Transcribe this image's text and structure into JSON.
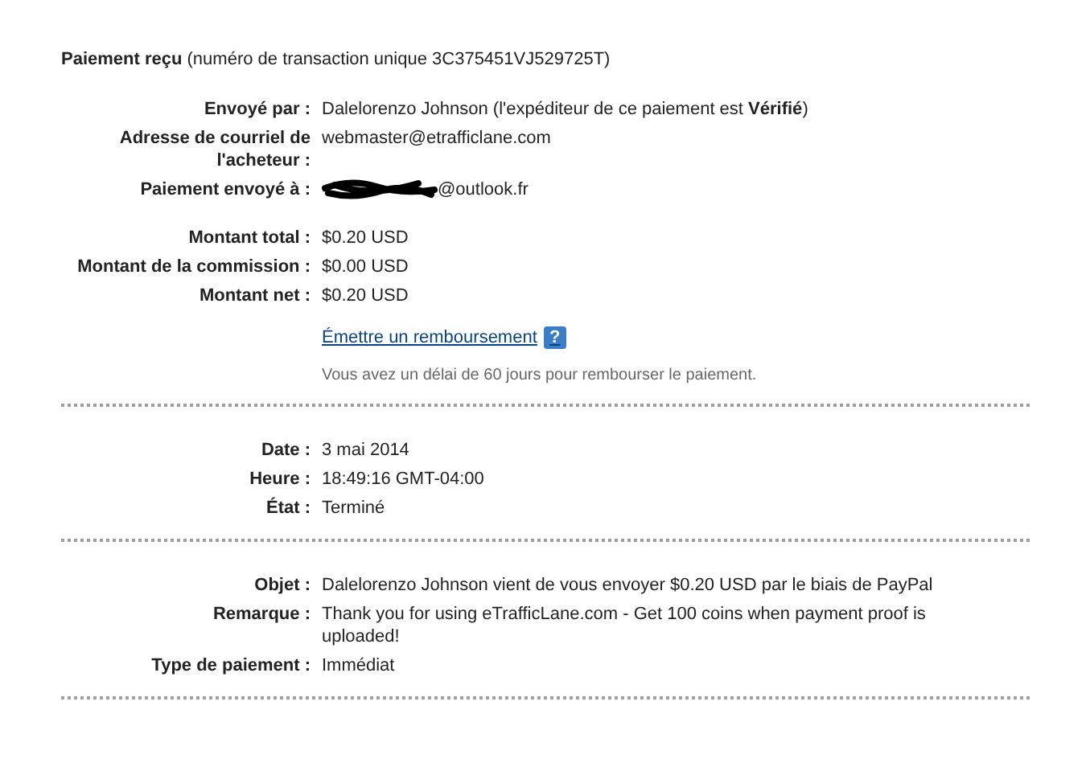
{
  "header": "**Paiement reçu** (numéro de transaction unique 3C375451VJ529725T)",
  "sections": [
    {
      "groups": [
        [
          {
            "kind": "text",
            "label": "Envoyé par :",
            "value": "Dalelorenzo Johnson (l'expéditeur de ce paiement est **Vérifié**)"
          },
          {
            "kind": "text",
            "label": "Adresse de courriel de l'acheteur :",
            "value": "webmaster@etrafficlane.com"
          },
          {
            "kind": "redacted",
            "label": "Paiement envoyé à :",
            "value": "@outlook.fr"
          }
        ],
        [
          {
            "kind": "text",
            "label": "Montant total :",
            "value": "$0.20 USD"
          },
          {
            "kind": "text",
            "label": "Montant de la commission :",
            "value": "$0.00 USD"
          },
          {
            "kind": "text",
            "label": "Montant net :",
            "value": "$0.20 USD"
          },
          {
            "kind": "link",
            "value": "Émettre un remboursement",
            "help": "?"
          },
          {
            "kind": "note",
            "value": "Vous avez un délai de 60 jours pour rembourser le paiement."
          }
        ]
      ]
    },
    {
      "groups": [
        [
          {
            "kind": "text",
            "label": "Date :",
            "value": "3 mai 2014"
          },
          {
            "kind": "text",
            "label": "Heure :",
            "value": "18:49:16 GMT-04:00"
          },
          {
            "kind": "text",
            "label": "État :",
            "value": "Terminé"
          }
        ]
      ]
    },
    {
      "groups": [
        [
          {
            "kind": "text",
            "label": "Objet :",
            "value": "Dalelorenzo Johnson vient de vous envoyer $0.20 USD par le biais de PayPal"
          },
          {
            "kind": "text",
            "label": "Remarque :",
            "value": "Thank you for using eTrafficLane.com - Get 100 coins when payment proof is uploaded!"
          },
          {
            "kind": "text",
            "label": "Type de paiement :",
            "value": "Immédiat"
          }
        ]
      ]
    }
  ]
}
